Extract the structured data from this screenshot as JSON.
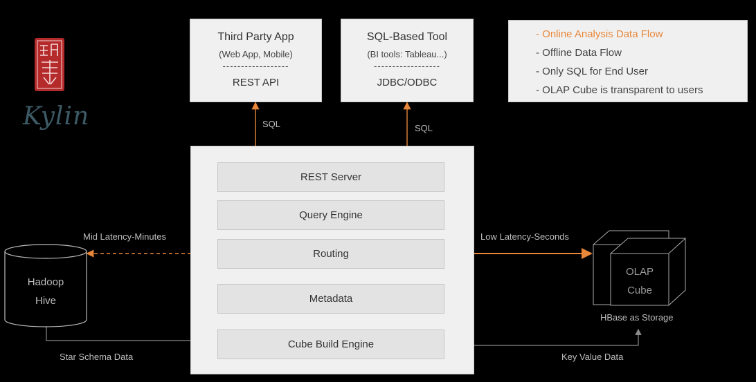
{
  "logo": {
    "text": "Kylin",
    "seal_color": "#b52a2a"
  },
  "third_party": {
    "title": "Third Party App",
    "subtitle": "(Web App, Mobile)",
    "divider": "------------------",
    "api": "REST API"
  },
  "sql_tool": {
    "title": "SQL-Based Tool",
    "subtitle": "(BI tools: Tableau...)",
    "divider": "------------------",
    "api": "JDBC/ODBC"
  },
  "legend": {
    "items": [
      {
        "text": "- Online Analysis Data Flow",
        "highlight": true
      },
      {
        "text": "- Offline Data Flow",
        "highlight": false
      },
      {
        "text": "- Only SQL for End User",
        "highlight": false
      },
      {
        "text": "- OLAP Cube is transparent to users",
        "highlight": false
      }
    ]
  },
  "kylin_stack": {
    "layers": [
      "REST Server",
      "Query Engine",
      "Routing",
      "Metadata",
      "Cube Build Engine"
    ]
  },
  "hadoop": {
    "line1": "Hadoop",
    "line2": "Hive"
  },
  "cube": {
    "line1": "OLAP",
    "line2": "Cube",
    "caption": "HBase as Storage"
  },
  "labels": {
    "sql_left": "SQL",
    "sql_right": "SQL",
    "mid_latency": "Mid Latency-Minutes",
    "low_latency": "Low Latency-Seconds",
    "star_schema": "Star Schema Data",
    "key_value": "Key Value Data"
  },
  "colors": {
    "accent": "#e8873a",
    "box_bg": "#f0f0f0",
    "layer_bg": "#e3e3e3",
    "line_gray": "#8a8a8a"
  }
}
